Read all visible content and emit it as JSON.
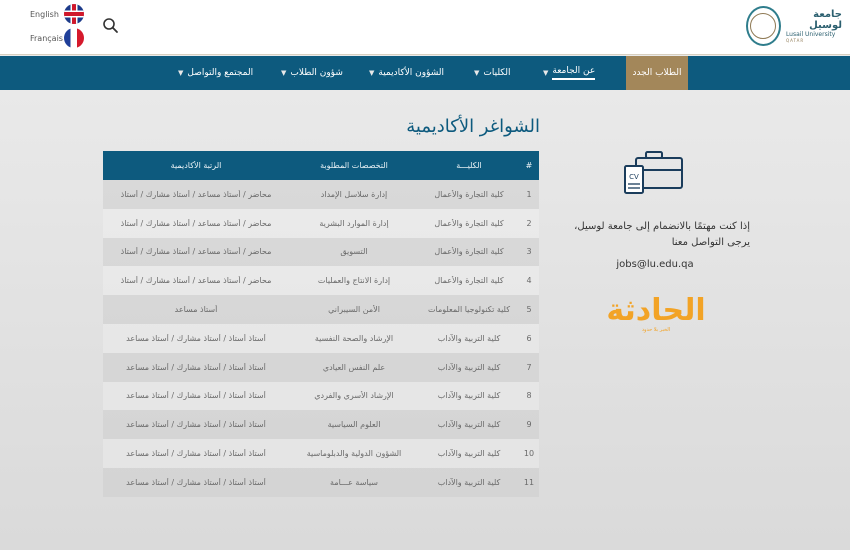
{
  "header": {
    "languages": [
      {
        "label": "English",
        "flag": "uk-flag-icon"
      },
      {
        "label": "Français",
        "flag": "france-flag-icon"
      }
    ],
    "search_icon": "search-icon",
    "logo": {
      "ar": "جامعة لوسيل",
      "en": "Lusail University",
      "qatar": "QATAR"
    }
  },
  "nav": {
    "new_students": "الطلاب الجدد",
    "items": [
      {
        "label": "عن الجامعة",
        "active": true
      },
      {
        "label": "الكليات"
      },
      {
        "label": "الشؤون الأكاديمية"
      },
      {
        "label": "شؤون الطلاب"
      },
      {
        "label": "المجتمع والتواصل"
      }
    ]
  },
  "page": {
    "title": "الشواغر الأكاديمية"
  },
  "table": {
    "headers": {
      "num": "#",
      "college": "الكليـــة",
      "spec": "التخصصات المطلوبة",
      "rank": "الرتبة الأكاديمية"
    },
    "rows": [
      {
        "num": "1",
        "college": "كلية التجارة والأعمال",
        "spec": "إدارة سلاسل الإمداد",
        "rank": "محاضر / أستاذ مساعد / أستاذ مشارك / أستاذ"
      },
      {
        "num": "2",
        "college": "كلية التجارة والأعمال",
        "spec": "إدارة الموارد البشرية",
        "rank": "محاضر / أستاذ مساعد / أستاذ مشارك / أستاذ"
      },
      {
        "num": "3",
        "college": "كلية التجارة والأعمال",
        "spec": "التسويق",
        "rank": "محاضر / أستاذ مساعد / أستاذ مشارك / أستاذ"
      },
      {
        "num": "4",
        "college": "كلية التجارة والأعمال",
        "spec": "إدارة الانتاج والعمليات",
        "rank": "محاضر / أستاذ مساعد / أستاذ مشارك / أستاذ"
      },
      {
        "num": "5",
        "college": "كلية تكنولوجيا المعلومات",
        "spec": "الأمن السيبراني",
        "rank": "أستاذ مساعد"
      },
      {
        "num": "6",
        "college": "كلية التربية والآداب",
        "spec": "الإرشاد والصحة النفسية",
        "rank": "أستاذ أستاذ / أستاذ مشارك / أستاذ مساعد"
      },
      {
        "num": "7",
        "college": "كلية التربية والآداب",
        "spec": "علم النفس العيادي",
        "rank": "أستاذ أستاذ / أستاذ مشارك / أستاذ مساعد"
      },
      {
        "num": "8",
        "college": "كلية التربية والآداب",
        "spec": "الإرشاد الأسري والفردي",
        "rank": "أستاذ أستاذ / أستاذ مشارك / أستاذ مساعد"
      },
      {
        "num": "9",
        "college": "كلية التربية والآداب",
        "spec": "العلوم السياسية",
        "rank": "أستاذ أستاذ / أستاذ مشارك / أستاذ مساعد"
      },
      {
        "num": "10",
        "college": "كلية التربية والآداب",
        "spec": "الشؤون الدولية والدبلوماسية",
        "rank": "أستاذ أستاذ / أستاذ مشارك / أستاذ مساعد"
      },
      {
        "num": "11",
        "college": "كلية التربية والآداب",
        "spec": "سياسة عـــامة",
        "rank": "أستاذ أستاذ / أستاذ مشارك / أستاذ مساعد"
      }
    ]
  },
  "side": {
    "icon": "cv-briefcase-icon",
    "contact_text": "إذا كنت مهتمًا بالانضمام إلى جامعة لوسيل، يرجى التواصل معنا",
    "email": "jobs@lu.edu.qa",
    "watermark_logo": {
      "main": "الحادثة",
      "tagline": "الخبر بلا حدود"
    }
  },
  "colors": {
    "nav": "#0d5a7e",
    "accent_gold": "#a3875a",
    "title": "#0d5a7e",
    "watermark": "#f2a326"
  }
}
